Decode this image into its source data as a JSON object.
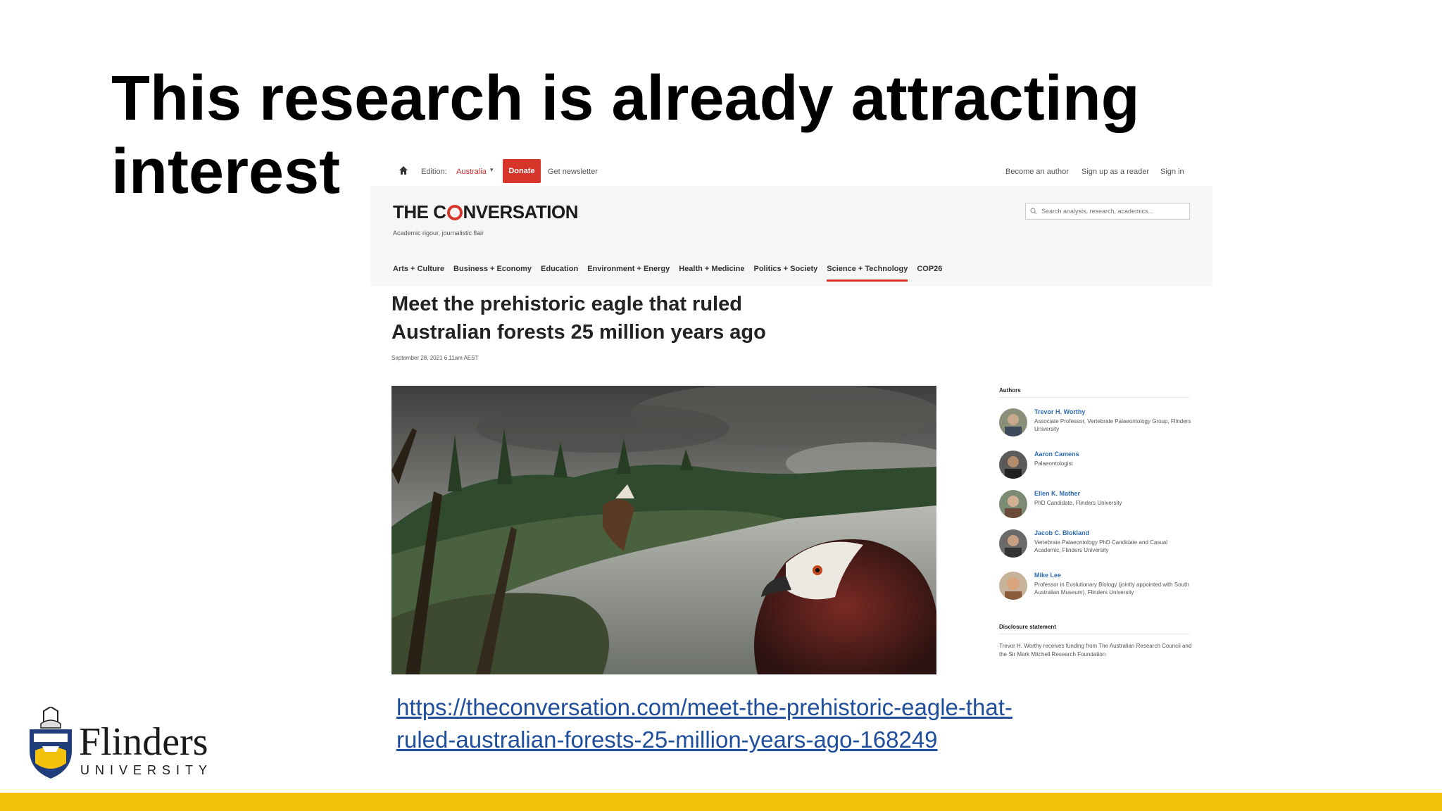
{
  "slide": {
    "title": "This research is already attracting interest",
    "link_line1": "https://theconversation.com/meet-the-prehistoric-eagle-that-",
    "link_line2": "ruled-australian-forests-25-million-years-ago-168249",
    "accent_color": "#f4c20d"
  },
  "university": {
    "name": "Flinders",
    "subtitle": "UNIVERSITY"
  },
  "topbar": {
    "edition_label": "Edition:",
    "edition_value": "Australia",
    "donate_label": "Donate",
    "newsletter_label": "Get newsletter",
    "become_author": "Become an author",
    "signup_reader": "Sign up as a reader",
    "signin": "Sign in"
  },
  "site": {
    "logo_part1": "THE C",
    "logo_part2": "NVERSATION",
    "tagline": "Academic rigour, journalistic flair",
    "search_placeholder": "Search analysis, research, academics...",
    "brand_color": "#d8352a"
  },
  "nav": {
    "items": [
      "Arts + Culture",
      "Business + Economy",
      "Education",
      "Environment + Energy",
      "Health + Medicine",
      "Politics + Society",
      "Science + Technology",
      "COP26"
    ],
    "active": "Science + Technology"
  },
  "article": {
    "headline_line1": "Meet the prehistoric eagle that ruled",
    "headline_line2": "Australian forests 25 million years ago",
    "dateline": "September 28, 2021 6.11am AEST"
  },
  "authors": {
    "heading": "Authors",
    "list": [
      {
        "name": "Trevor H. Worthy",
        "role": "Associate Professor, Vertebrate Palaeontology Group, Flinders University"
      },
      {
        "name": "Aaron Camens",
        "role": "Palaeontologist"
      },
      {
        "name": "Ellen K. Mather",
        "role": "PhD Candidate, Flinders University"
      },
      {
        "name": "Jacob C. Blokland",
        "role": "Vertebrate Palaeontology PhD Candidate and Casual Academic, Flinders University"
      },
      {
        "name": "Mike Lee",
        "role": "Professor in Evolutionary Biology (jointly appointed with South Australian Museum), Flinders University"
      }
    ]
  },
  "disclosure": {
    "heading": "Disclosure statement",
    "text": "Trevor H. Worthy receives funding from The Australian Research Council and the Sir Mark Mitchell Research Foundation"
  }
}
